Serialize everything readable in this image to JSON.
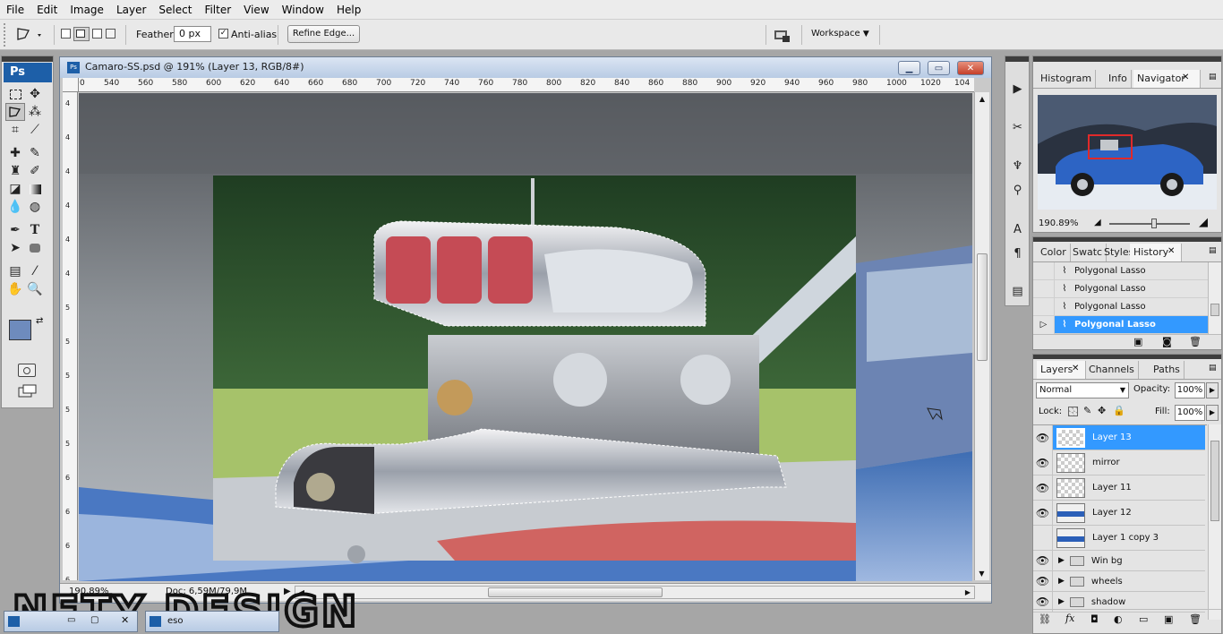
{
  "menu": [
    "File",
    "Edit",
    "Image",
    "Layer",
    "Select",
    "Filter",
    "View",
    "Window",
    "Help"
  ],
  "options": {
    "feather_label": "Feather:",
    "feather_value": "0 px",
    "antialias_label": "Anti-alias",
    "antialias_checked": true,
    "refine_edge": "Refine Edge...",
    "workspace": "Workspace"
  },
  "toolbox": {
    "logo": "Ps"
  },
  "document": {
    "title": "Camaro-SS.psd @ 191% (Layer 13, RGB/8#)",
    "ruler_h": [
      "0",
      "540",
      "560",
      "580",
      "600",
      "620",
      "640",
      "660",
      "680",
      "700",
      "720",
      "740",
      "760",
      "780",
      "800",
      "820",
      "840",
      "860",
      "880",
      "900",
      "920",
      "940",
      "960",
      "980",
      "1000",
      "1020",
      "104"
    ],
    "ruler_v": [
      "4",
      "4",
      "4",
      "4",
      "4",
      "4",
      "5",
      "5",
      "5",
      "5",
      "5",
      "6",
      "6",
      "6",
      "6"
    ],
    "zoom": "190,89%",
    "doc_size": "Doc: 6,59M/79,9M"
  },
  "navigator": {
    "tabs": [
      "Histogram",
      "Info",
      "Navigator"
    ],
    "active_tab": "Navigator",
    "zoom": "190.89%"
  },
  "history": {
    "tabs": [
      "Color",
      "Swatc",
      "Styles",
      "History"
    ],
    "active_tab": "History",
    "items": [
      "Polygonal Lasso",
      "Polygonal Lasso",
      "Polygonal Lasso",
      "Polygonal Lasso"
    ],
    "selected_index": 3
  },
  "layers": {
    "tabs": [
      "Layers",
      "Channels",
      "Paths"
    ],
    "active_tab": "Layers",
    "blend_mode": "Normal",
    "opacity_label": "Opacity:",
    "opacity": "100%",
    "lock_label": "Lock:",
    "fill_label": "Fill:",
    "fill": "100%",
    "items": [
      {
        "name": "Layer 13",
        "visible": true,
        "selected": true
      },
      {
        "name": "mirror",
        "visible": true,
        "selected": false
      },
      {
        "name": "Layer 11",
        "visible": true,
        "selected": false
      },
      {
        "name": "Layer 12",
        "visible": true,
        "selected": false
      },
      {
        "name": "Layer 1 copy 3",
        "visible": false,
        "selected": false
      }
    ],
    "groups": [
      "Win bg",
      "wheels",
      "shadow"
    ]
  },
  "watermark": "NETY DESIGN",
  "taskbar_item": "eso",
  "colors": {
    "selection": "#3399ff",
    "ps_blue": "#1d5fa8",
    "titlebar": "#c5d4ea",
    "close_red": "#c9452e"
  }
}
